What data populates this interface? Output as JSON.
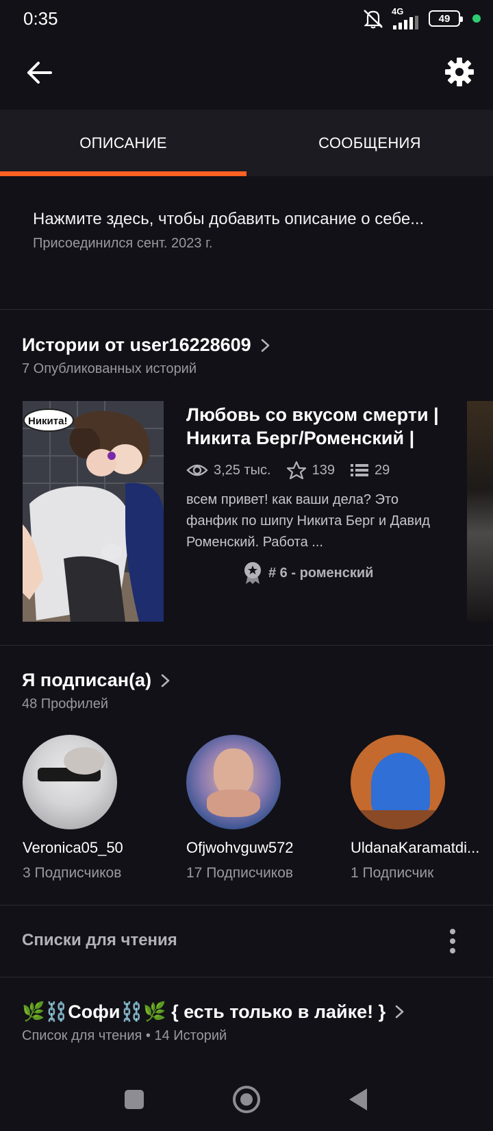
{
  "status_bar": {
    "time": "0:35",
    "network": "4G",
    "battery": "49",
    "icons": [
      "mute-icon",
      "signal-icon",
      "battery-icon",
      "privacy-dot-icon"
    ]
  },
  "app_bar": {
    "back_icon": "arrow-left-icon",
    "settings_icon": "gear-icon"
  },
  "tabs": [
    {
      "label": "ОПИСАНИЕ",
      "active": true
    },
    {
      "label": "СООБЩЕНИЯ",
      "active": false
    }
  ],
  "colors": {
    "accent": "#ff6122",
    "background": "#121117",
    "tab_bar": "#1c1b21",
    "secondary_text": "#9a99a0"
  },
  "description": {
    "prompt": "Нажмите здесь, чтобы добавить описание о себе...",
    "joined": "Присоединился сент. 2023 г."
  },
  "stories_section": {
    "title": "Истории от user16228609",
    "subtitle": "7 Опубликованных историй",
    "story": {
      "cover_speech_bubble": "Никита!",
      "title": "Любовь со вкусом смерти | Никита Берг/Роменский |",
      "reads": "3,25 тыс.",
      "votes": "139",
      "parts": "29",
      "description": "всем привет! как ваши дела? Это фанфик по шипу Никита Берг и Давид Роменский. Работа ...",
      "rank_tag": "# 6 - роменский"
    }
  },
  "following_section": {
    "title": "Я подписан(а)",
    "subtitle": "48 Профилей",
    "profiles": [
      {
        "name": "Veronica05_50",
        "followers": "3 Подписчиков"
      },
      {
        "name": "Ofjwohvguw572",
        "followers": "17 Подписчиков"
      },
      {
        "name": "UldanaKaramatdi...",
        "followers": "1 Подписчик"
      }
    ]
  },
  "reading_lists": {
    "header": "Списки для чтения",
    "list": {
      "title": "🌿⛓️Софи⛓️🌿 { есть только в лайке! }",
      "subtitle": "Список для чтения • 14 Историй"
    }
  },
  "nav_bar": {
    "icons": [
      "recents-square-icon",
      "home-circle-icon",
      "back-triangle-icon"
    ]
  }
}
